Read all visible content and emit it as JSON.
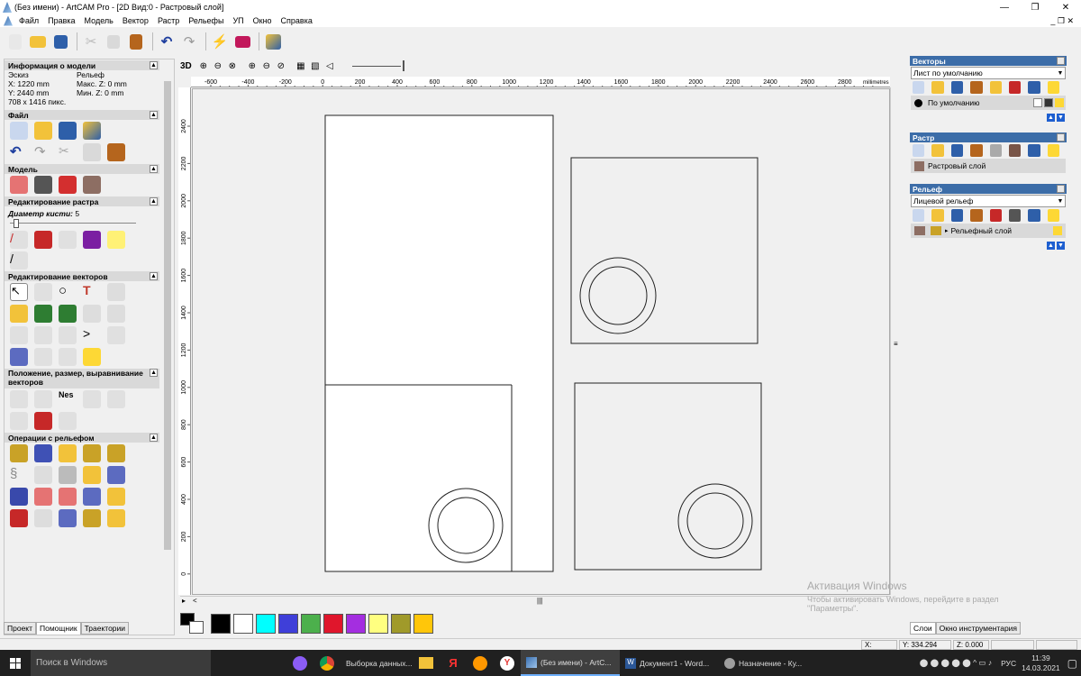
{
  "window": {
    "title": "(Без имени) - ArtCAM Pro - [2D Вид:0 - Растровый слой]",
    "min": "—",
    "max": "❐",
    "close": "✕",
    "inner_controls": "_ ❐ ✕"
  },
  "menu": [
    "Файл",
    "Правка",
    "Модель",
    "Вектор",
    "Растр",
    "Рельефы",
    "УП",
    "Окно",
    "Справка"
  ],
  "toolbar": {
    "icons": [
      "new-icon",
      "open-icon",
      "save-icon",
      "cut-icon",
      "copy-icon",
      "paste-icon",
      "undo-icon",
      "redo-icon",
      "wizard-icon",
      "book-icon",
      "assistant-icon"
    ]
  },
  "view_toolbar": {
    "label_3d": "3D",
    "zoom_glyphs": [
      "⊕",
      "⊖",
      "⊗",
      "⊕",
      "⊖",
      "⊘",
      "▦",
      "▧",
      "◁"
    ]
  },
  "left_panel": {
    "model_info": {
      "header": "Информация о модели",
      "col1_title": "Эскиз",
      "col2_title": "Рельеф",
      "x": "X: 1220 mm",
      "y": "Y: 2440 mm",
      "size_px": "708 x 1416 пикс.",
      "max_z": "Макс. Z: 0 mm",
      "min_z": "Мин. Z: 0 mm"
    },
    "file": {
      "header": "Файл"
    },
    "model": {
      "header": "Модель"
    },
    "raster": {
      "header": "Редактирование растра",
      "brush_label": "Диаметр кисти:",
      "brush_value": "5"
    },
    "vectors": {
      "header": "Редактирование векторов"
    },
    "position": {
      "header": "Положение, размер, выравнивание векторов"
    },
    "relief_ops": {
      "header": "Операции с рельефом"
    },
    "tabs": [
      "Проект",
      "Помощник",
      "Траектории"
    ],
    "active_tab": 1
  },
  "ruler": {
    "h_labels": [
      "-600",
      "-400",
      "-200",
      "0",
      "200",
      "400",
      "600",
      "800",
      "1000",
      "1200",
      "1400",
      "1600",
      "1800",
      "2000",
      "2200",
      "2400",
      "2600",
      "2800"
    ],
    "units": "millimetres",
    "v_labels": [
      "2400",
      "2200",
      "2000",
      "1800",
      "1600",
      "1400",
      "1200",
      "1000",
      "800",
      "600",
      "400",
      "200",
      "0"
    ]
  },
  "palette": {
    "colors": [
      "#000000",
      "#ffffff",
      "#00ffff",
      "#3f3fd9",
      "#4cb04c",
      "#e0162c",
      "#a42ee0",
      "#ffff80",
      "#a09a2a",
      "#ffc60a"
    ]
  },
  "right_panel": {
    "vectors": {
      "header": "Векторы",
      "sheet": "Лист по умолчанию",
      "layer": "По умолчанию"
    },
    "raster": {
      "header": "Растр",
      "layer": "Растровый слой"
    },
    "relief": {
      "header": "Рельеф",
      "relief_name": "Лицевой рельеф",
      "layer": "Рельефный слой"
    },
    "tabs": [
      "Слои",
      "Окно инструментария"
    ],
    "active_tab": 0
  },
  "status": {
    "x": "X: 425.621",
    "y": "Y: 334.294",
    "z": "Z: 0.000"
  },
  "watermark": {
    "line1": "Активация Windows",
    "line2": "Чтобы активировать Windows, перейдите в раздел",
    "line3": "\"Параметры\"."
  },
  "taskbar": {
    "search": "Поиск в Windows",
    "apps": [
      "",
      "",
      "Выборка данных...",
      "",
      "",
      "",
      "",
      "",
      "(Без имени) - ArtC...",
      "Документ1 - Word...",
      "Назначение - Ку..."
    ],
    "lang": "РУС",
    "time": "11:39",
    "date": "14.03.2021"
  }
}
